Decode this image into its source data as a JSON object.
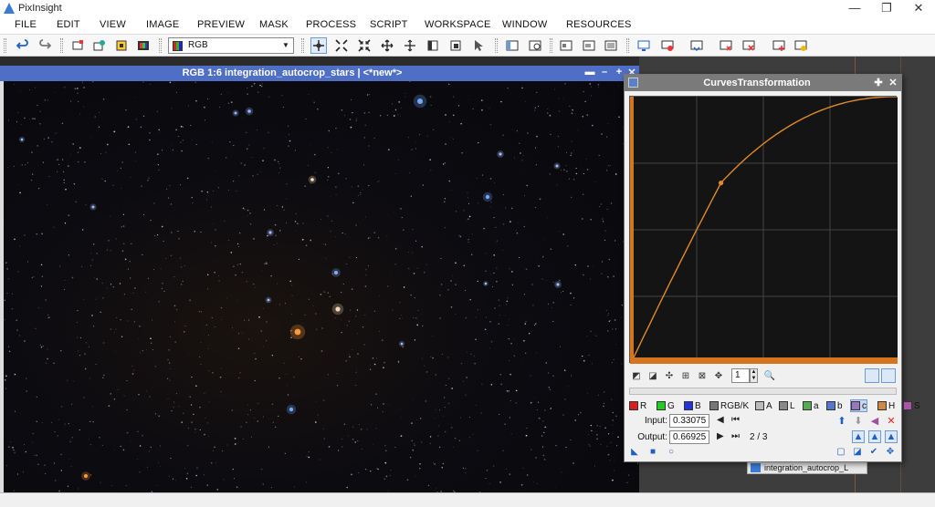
{
  "app": {
    "title": "PixInsight"
  },
  "menu": [
    "FILE",
    "EDIT",
    "VIEW",
    "IMAGE",
    "PREVIEW",
    "MASK",
    "PROCESS",
    "SCRIPT",
    "WORKSPACE",
    "WINDOW",
    "RESOURCES"
  ],
  "toolbar": {
    "channel_select": "RGB"
  },
  "image_window": {
    "title": "RGB 1:6 integration_autocrop_stars | <*new*>"
  },
  "curves": {
    "title": "CurvesTransformation",
    "zoom": "1",
    "channels": [
      {
        "label": "R",
        "color": "#d81f1f"
      },
      {
        "label": "G",
        "color": "#22cc22"
      },
      {
        "label": "B",
        "color": "#2233dd"
      },
      {
        "label": "RGB/K",
        "color": "#777777"
      },
      {
        "label": "A",
        "color": "#bbbbbb"
      },
      {
        "label": "L",
        "color": "#888888"
      },
      {
        "label": "a",
        "color": "#55aa55"
      },
      {
        "label": "b",
        "color": "#5577cc"
      },
      {
        "label": "c",
        "color": "#9977bb"
      },
      {
        "label": "H",
        "color": "#cc8844"
      },
      {
        "label": "S",
        "color": "#aa55aa"
      }
    ],
    "selected_channel": "c",
    "input_label": "Input:",
    "input_value": "0.33075",
    "output_label": "Output:",
    "output_value": "0.66925",
    "point_index": "2 / 3",
    "curve_color": "#e08a2a",
    "control_point": {
      "x": 0.33075,
      "y": 0.66925
    }
  },
  "icon_bar": {
    "label": "integration_autocrop_L"
  }
}
